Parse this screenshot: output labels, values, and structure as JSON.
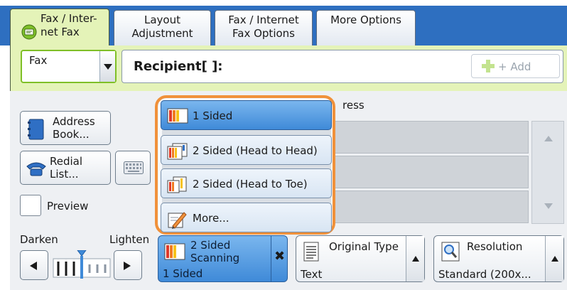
{
  "tabs": [
    {
      "label_line1": "Fax / Inter-",
      "label_line2": "net Fax",
      "active": true
    },
    {
      "label_line1": "Layout",
      "label_line2": "Adjustment"
    },
    {
      "label_line1": "Fax / Internet",
      "label_line2": "Fax Options"
    },
    {
      "label_line1": "More Options",
      "label_line2": ""
    }
  ],
  "recipient_bar": {
    "mode_select": "Fax",
    "recipient_label": "Recipient[   ]:",
    "add_button": "+ Add"
  },
  "side": {
    "address_book_line1": "Address",
    "address_book_line2": "Book...",
    "redial_line1": "Redial",
    "redial_line2": "List...",
    "preview_label": "Preview"
  },
  "list": {
    "header_fragment": "ress"
  },
  "density": {
    "darken_label": "Darken",
    "lighten_label": "Lighten",
    "level": 3,
    "levels": 7
  },
  "features": {
    "two_sided": {
      "title_line1": "2 Sided",
      "title_line2": "Scanning",
      "value": "1 Sided",
      "clear_symbol": "✖"
    },
    "original_type": {
      "title": "Original Type",
      "value": "Text"
    },
    "resolution": {
      "title": "Resolution",
      "value": "Standard (200x..."
    }
  },
  "popup_menu": {
    "items": [
      {
        "label": "1 Sided",
        "icon": "one-sided-icon",
        "selected": true
      },
      {
        "label": "2 Sided (Head to Head)",
        "icon": "two-sided-head-to-head-icon"
      },
      {
        "label": "2 Sided (Head to Toe)",
        "icon": "two-sided-head-to-toe-icon"
      },
      {
        "label": "More...",
        "icon": "more-pencil-icon"
      }
    ]
  },
  "colors": {
    "tab_bar": "#2e6fc0",
    "active_green": "#e4f3b8",
    "selected_blue": "#4a94dd",
    "highlight_orange": "#f0913a"
  }
}
